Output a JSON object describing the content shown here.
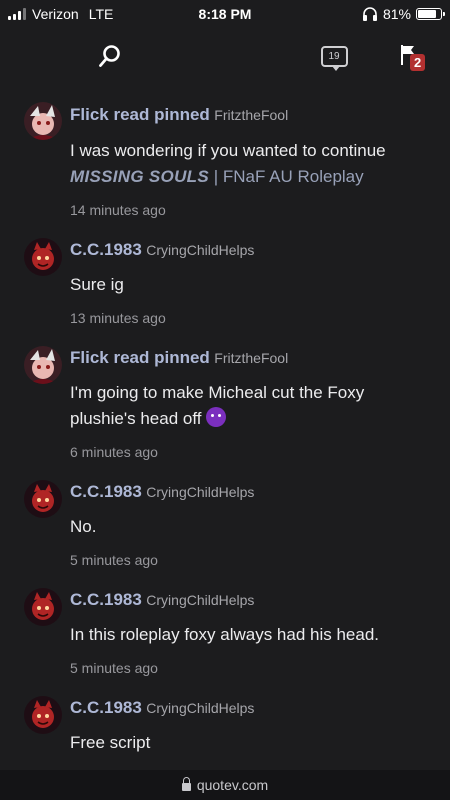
{
  "status_bar": {
    "carrier": "Verizon",
    "network": "LTE",
    "time": "8:18 PM",
    "battery_percent": "81%",
    "battery_level": 0.81,
    "icons": [
      "signal-icon",
      "headphones-icon",
      "battery-icon"
    ]
  },
  "nav": {
    "notification_count": "19",
    "flag_badge": "2",
    "icons": [
      "menu-icon",
      "search-icon",
      "notification-icon",
      "flag-icon"
    ]
  },
  "feed": [
    {
      "user": "Flick read pinned",
      "handle": "FritztheFool",
      "text_prefix": "I was wondering if you wanted to continue ",
      "title": "MISSING SOULS",
      "text_suffix": " | FNaF AU Roleplay",
      "time": "14 minutes ago",
      "avatar": "flick"
    },
    {
      "user": "C.C.1983",
      "handle": "CryingChildHelps",
      "text": "Sure ig",
      "time": "13 minutes ago",
      "avatar": "cc"
    },
    {
      "user": "Flick read pinned",
      "handle": "FritztheFool",
      "text": "I'm going to make Micheal cut the Foxy plushie's head off",
      "emoji": "smiling-imp-emoji",
      "time": "6 minutes ago",
      "avatar": "flick"
    },
    {
      "user": "C.C.1983",
      "handle": "CryingChildHelps",
      "text": "No.",
      "time": "5 minutes ago",
      "avatar": "cc"
    },
    {
      "user": "C.C.1983",
      "handle": "CryingChildHelps",
      "text": "In this roleplay foxy always had his head.",
      "time": "5 minutes ago",
      "avatar": "cc"
    },
    {
      "user": "C.C.1983",
      "handle": "CryingChildHelps",
      "text": "Free script",
      "time": "",
      "avatar": "cc"
    }
  ],
  "url_bar": {
    "domain": "quotev.com"
  },
  "colors": {
    "background": "#1c1c1e",
    "username": "#aeb8d6",
    "badge": "#b23030",
    "emoji": "#7b2fbe"
  }
}
